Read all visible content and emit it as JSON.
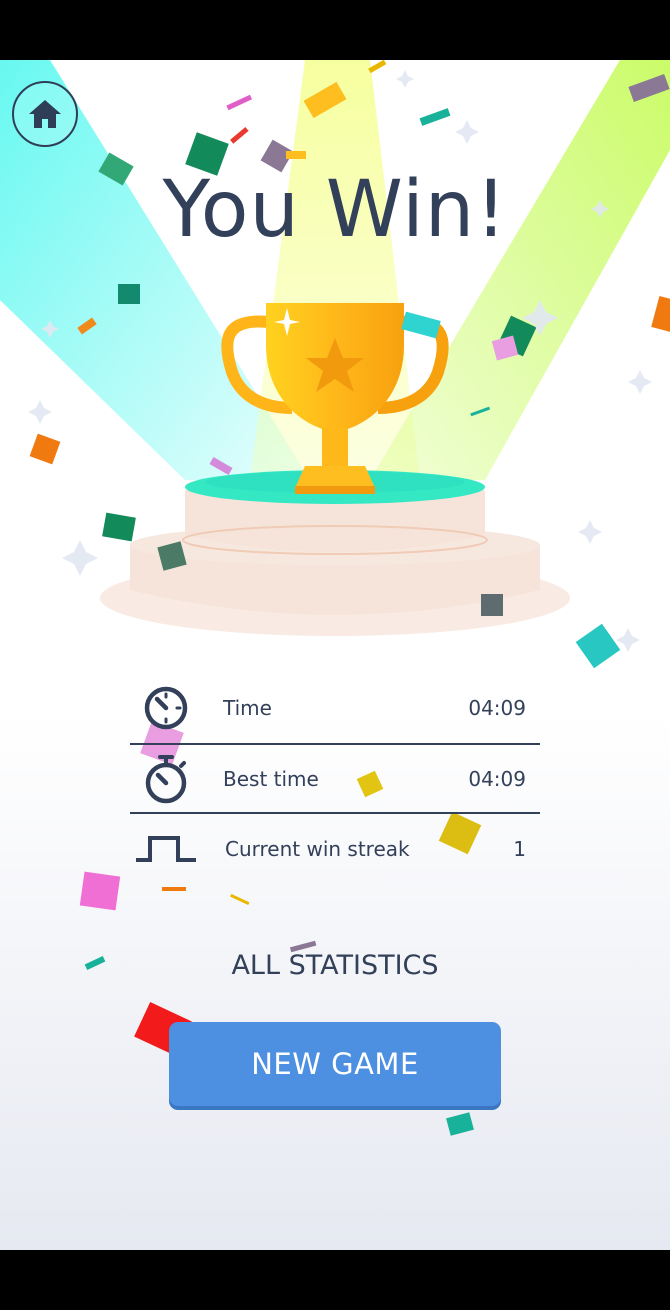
{
  "title": "You Win!",
  "stats": [
    {
      "label": "Time",
      "value": "04:09",
      "icon": "clock-icon"
    },
    {
      "label": "Best time",
      "value": "04:09",
      "icon": "stopwatch-icon"
    },
    {
      "label": "Current win streak",
      "value": "1",
      "icon": "streak-icon"
    }
  ],
  "all_statistics_label": "ALL STATISTICS",
  "new_game_label": "NEW GAME",
  "icons": {
    "home": "home-icon",
    "trophy": "trophy-icon"
  },
  "colors": {
    "text": "#33405a",
    "button": "#4d8fe0",
    "beam_left": "#5ff8f0",
    "beam_center": "#f6ff9a",
    "beam_right": "#cdfc6a",
    "trophy": "#ffbf1f",
    "podium": "#f6e4da"
  }
}
